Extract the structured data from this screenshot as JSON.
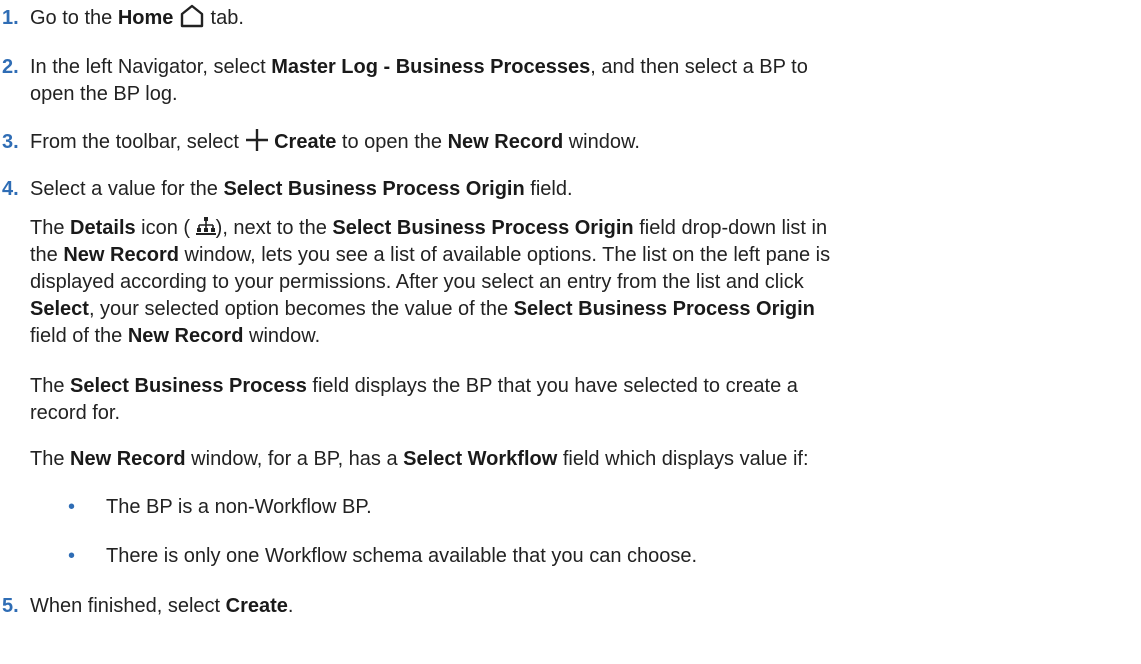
{
  "steps": [
    {
      "num": "1.",
      "pre": "Go to the ",
      "b1": "Home",
      "post": " tab."
    },
    {
      "num": "2.",
      "pre": "In the left Navigator, select ",
      "b1": "Master Log - Business Processes",
      "post": ", and then select a BP to",
      "cont": "open the BP log."
    },
    {
      "num": "3.",
      "pre": "From the toolbar, select ",
      "b1": "Create",
      "mid": " to open the ",
      "b2": "New Record",
      "post": " window."
    },
    {
      "num": "4.",
      "pre": "Select a value for the ",
      "b1": "Select Business Process Origin",
      "post": " field."
    },
    {
      "num": "5.",
      "pre": "When finished, select ",
      "b1": "Create",
      "post": "."
    }
  ],
  "details_para": {
    "l1": {
      "t1": "The ",
      "b1": "Details",
      "t2": " icon ( ",
      "t3": "), next to the ",
      "b2": "Select Business Process Origin",
      "t4": " field drop-down list in"
    },
    "l2": {
      "t1": "the ",
      "b1": "New Record",
      "t2": " window, lets you see a list of available options. The list on the left pane is"
    },
    "l3": {
      "t1": "displayed according to your permissions. After you select an entry from the list and click"
    },
    "l4": {
      "b1": "Select",
      "t1": ", your selected option becomes the value of the ",
      "b2": "Select Business Process Origin"
    },
    "l5": {
      "t1": "field of the ",
      "b1": "New Record",
      "t2": " window."
    }
  },
  "bp_para": {
    "l1": {
      "t1": "The ",
      "b1": "Select Business Process",
      "t2": " field displays the BP that you have selected to create a"
    },
    "l2": {
      "t1": "record for."
    }
  },
  "workflow_para": {
    "t1": "The ",
    "b1": "New Record",
    "t2": " window, for a BP, has a ",
    "b2": "Select Workflow",
    "t3": " field which displays value if:"
  },
  "bullets": [
    {
      "mark": "•",
      "text": "The BP is a non-Workflow BP."
    },
    {
      "mark": "•",
      "text": "There is only one Workflow schema available that you can choose."
    }
  ],
  "icons": {
    "home": "home-icon",
    "create": "plus-icon",
    "details": "hierarchy-icon"
  },
  "colors": {
    "number": "#2f6db5",
    "text": "#222222"
  }
}
